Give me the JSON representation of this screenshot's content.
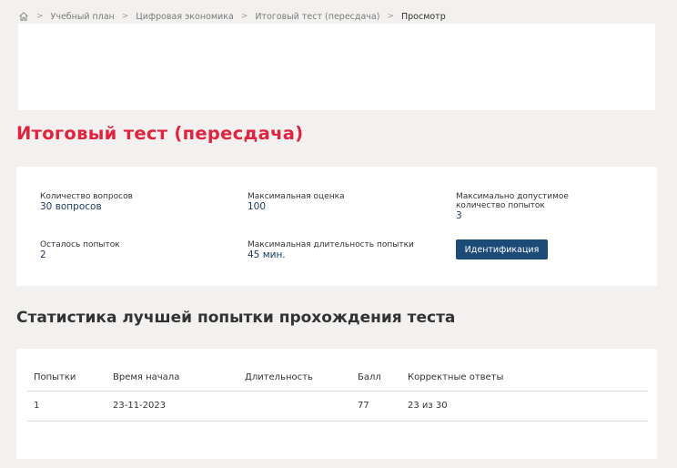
{
  "breadcrumb": {
    "items": [
      "Учебный план",
      "Цифровая экономика",
      "Итоговый тест (пересдача)"
    ],
    "current": "Просмотр"
  },
  "page": {
    "title": "Итоговый тест (пересдача)"
  },
  "info": {
    "questions_label": "Количество вопросов",
    "questions_value": "30 вопросов",
    "max_score_label": "Максимальная оценка",
    "max_score_value": "100",
    "max_attempts_label": "Максимально допустимое количество попыток",
    "max_attempts_value": "3",
    "remaining_label": "Осталось попыток",
    "remaining_value": "2",
    "duration_label": "Максимальная длительность попытки",
    "duration_value": "45 мин.",
    "identify_button": "Идентификация"
  },
  "stats": {
    "title": "Статистика лучшей попытки прохождения теста",
    "columns": [
      "Попытки",
      "Время начала",
      "Длительность",
      "Балл",
      "Корректные ответы"
    ],
    "rows": [
      [
        "1",
        "23-11-2023",
        "",
        "77",
        "23 из 30"
      ]
    ]
  },
  "colors": {
    "title_red": "#e0243f",
    "button_blue": "#1d4b78",
    "value_navy": "#1d3a5c",
    "background": "#f2f1ef"
  }
}
